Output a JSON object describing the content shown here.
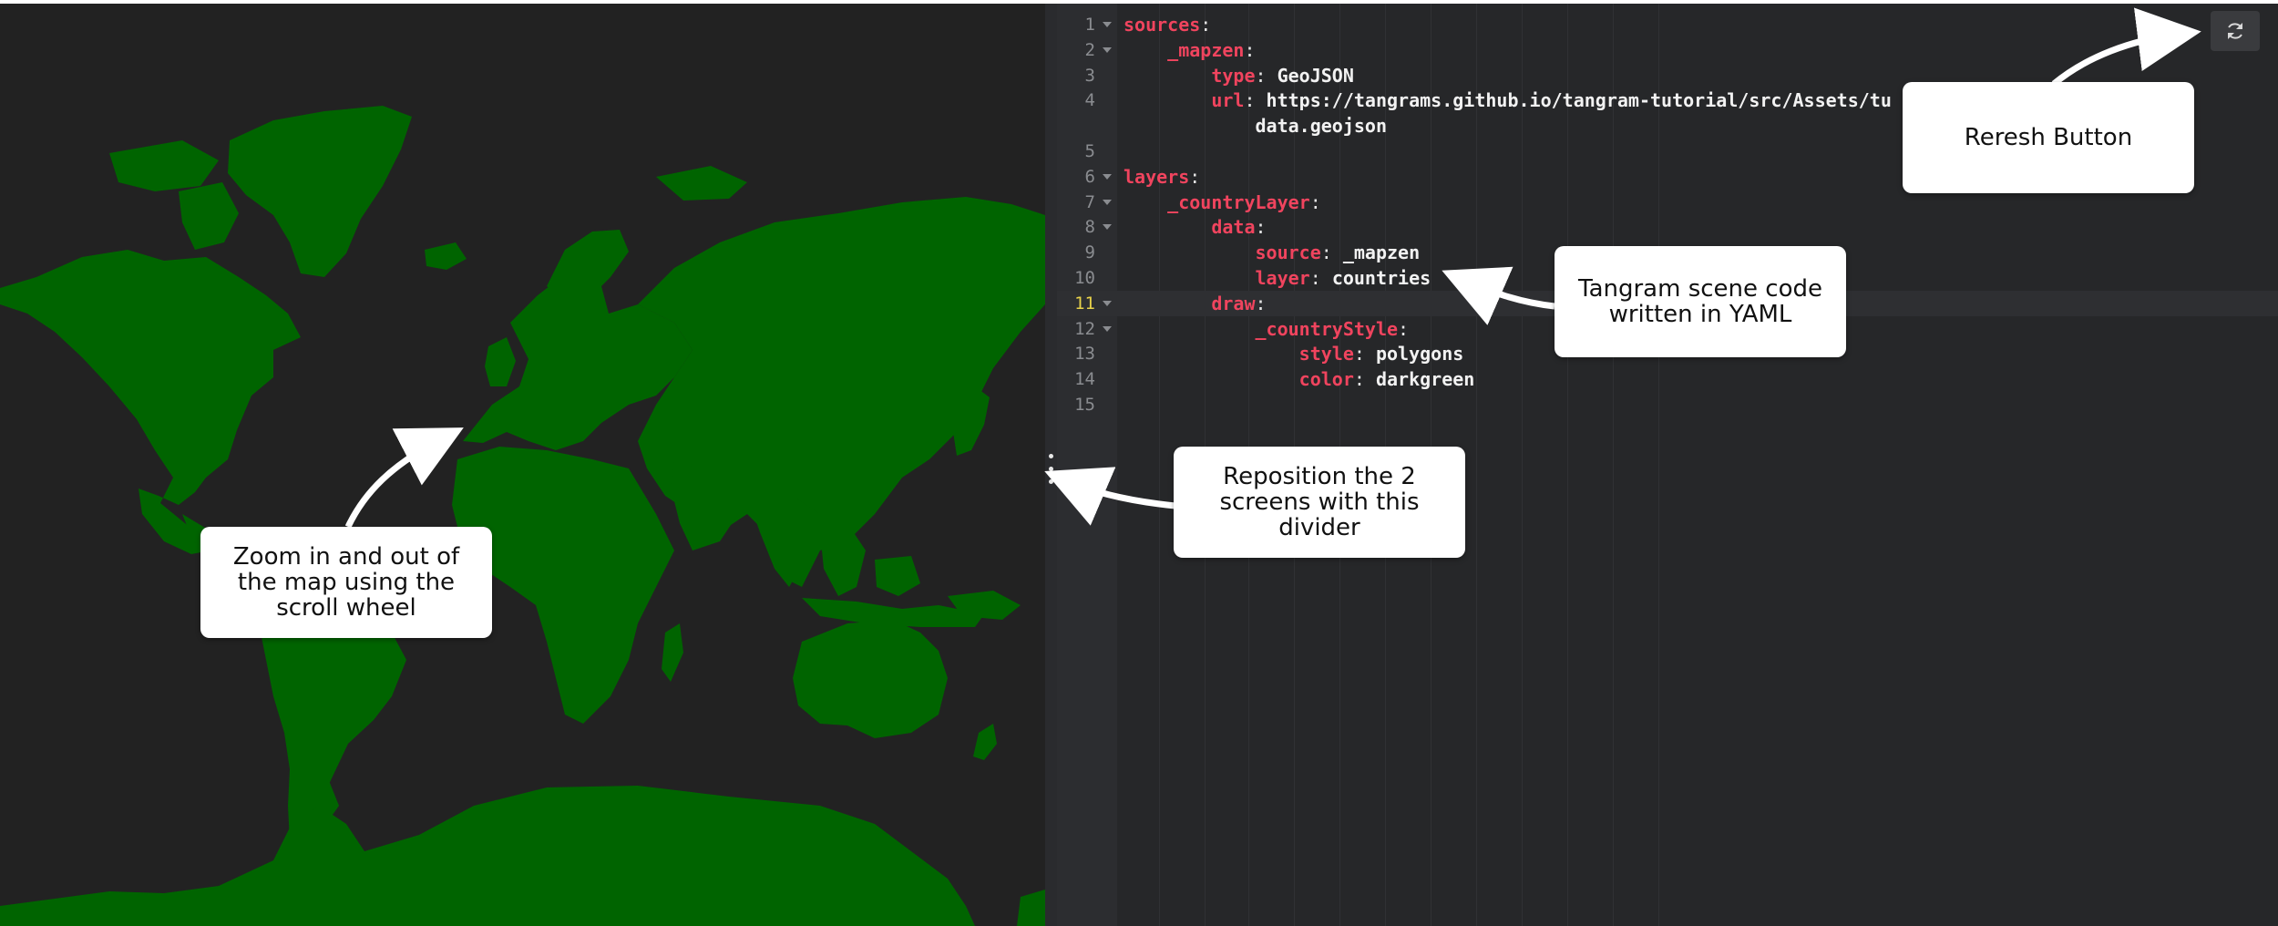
{
  "editor": {
    "lines": [
      {
        "n": "1",
        "indent": "",
        "key": "sources",
        "sep": ":",
        "value": "",
        "fold": true
      },
      {
        "n": "2",
        "indent": "    ",
        "key": "_mapzen",
        "sep": ":",
        "value": "",
        "fold": true
      },
      {
        "n": "3",
        "indent": "        ",
        "key": "type",
        "sep": ": ",
        "value": "GeoJSON",
        "fold": false
      },
      {
        "n": "4",
        "indent": "        ",
        "key": "url",
        "sep": ": ",
        "value": "https://tangrams.github.io/tangram-tutorial/src/Assets/tu",
        "fold": false
      },
      {
        "n": "",
        "indent": "            ",
        "key": "",
        "sep": "",
        "value": "data.geojson",
        "fold": false
      },
      {
        "n": "5",
        "indent": "",
        "key": "",
        "sep": "",
        "value": "",
        "fold": false
      },
      {
        "n": "6",
        "indent": "",
        "key": "layers",
        "sep": ":",
        "value": "",
        "fold": true
      },
      {
        "n": "7",
        "indent": "    ",
        "key": "_countryLayer",
        "sep": ":",
        "value": "",
        "fold": true
      },
      {
        "n": "8",
        "indent": "        ",
        "key": "data",
        "sep": ":",
        "value": "",
        "fold": true
      },
      {
        "n": "9",
        "indent": "            ",
        "key": "source",
        "sep": ": ",
        "value": "_mapzen",
        "fold": false
      },
      {
        "n": "10",
        "indent": "            ",
        "key": "layer",
        "sep": ": ",
        "value": "countries",
        "fold": false
      },
      {
        "n": "11",
        "indent": "        ",
        "key": "draw",
        "sep": ":",
        "value": "",
        "fold": true,
        "active": true
      },
      {
        "n": "12",
        "indent": "            ",
        "key": "_countryStyle",
        "sep": ":",
        "value": "",
        "fold": true
      },
      {
        "n": "13",
        "indent": "                ",
        "key": "style",
        "sep": ": ",
        "value": "polygons",
        "fold": false
      },
      {
        "n": "14",
        "indent": "                ",
        "key": "color",
        "sep": ": ",
        "value": "darkgreen",
        "fold": false
      },
      {
        "n": "15",
        "indent": "",
        "key": "",
        "sep": "",
        "value": "",
        "fold": false
      }
    ]
  },
  "toolbar": {
    "refresh_icon": "refresh-icon"
  },
  "callouts": {
    "refresh": [
      "Reresh Button"
    ],
    "yaml": [
      "Tangram scene code",
      "written in YAML"
    ],
    "divider": [
      "Reposition the 2",
      "screens with this",
      "divider"
    ],
    "zoom": [
      "Zoom in and out of",
      "the map using the",
      "scroll wheel"
    ]
  },
  "colors": {
    "land": "#006400",
    "map_background": "#222222",
    "editor_background": "#262729",
    "yaml_key": "#f0445e",
    "active_line_number": "#e8d24a"
  }
}
